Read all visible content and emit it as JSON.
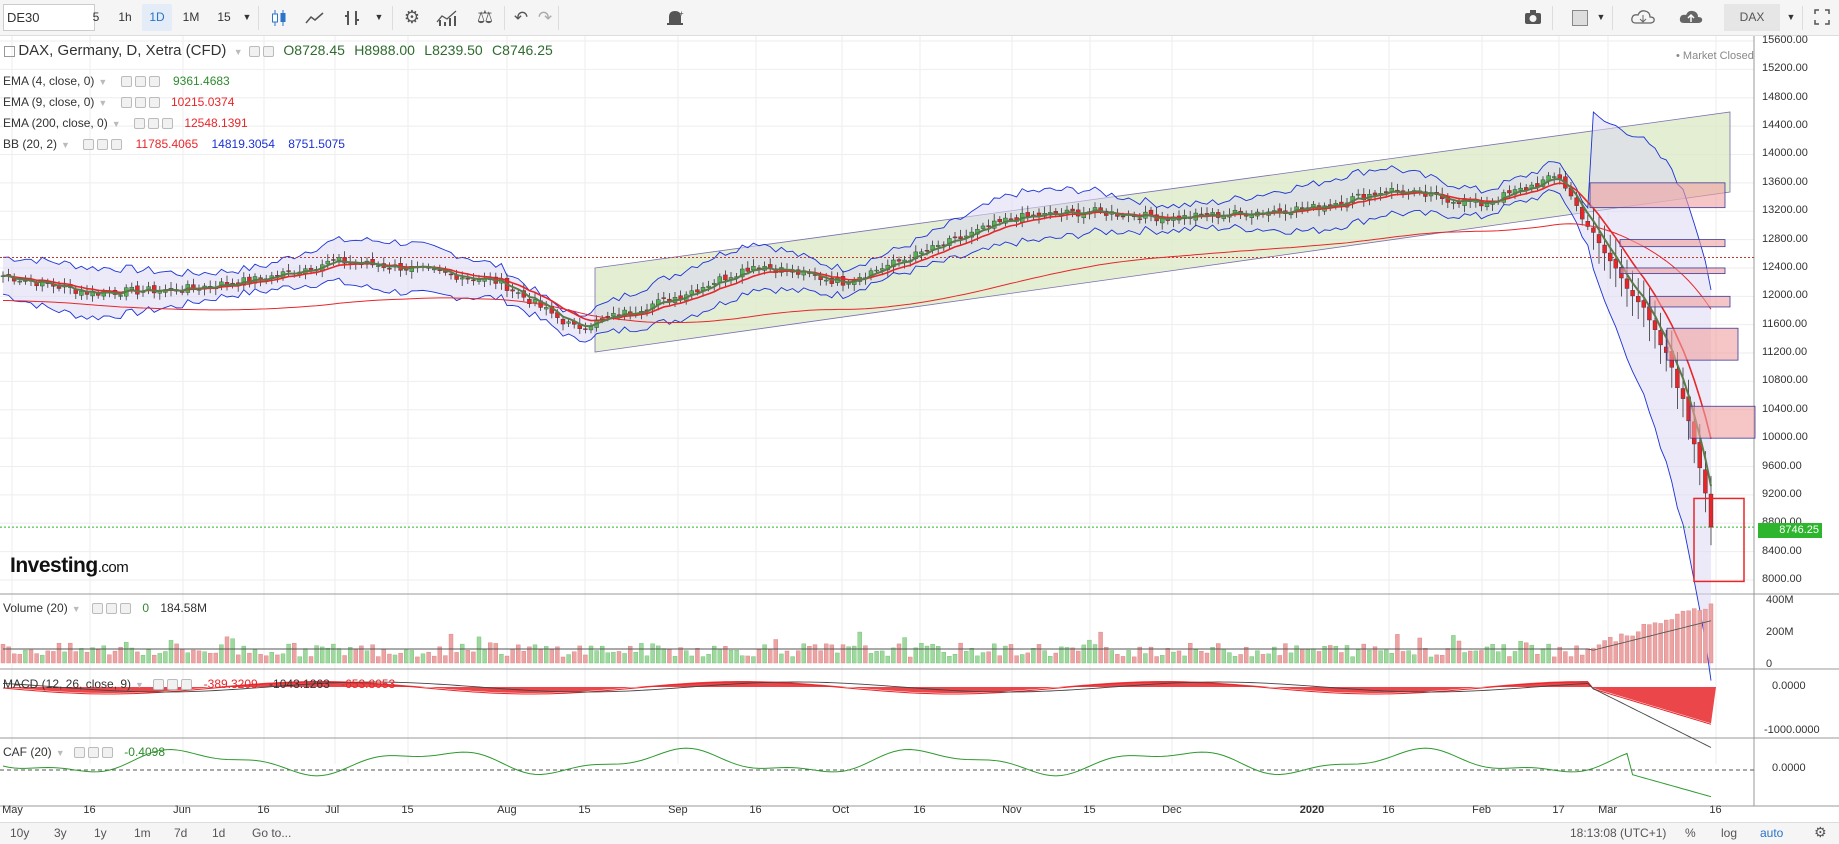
{
  "toolbar": {
    "symbol": "DE30",
    "intervals": [
      "5",
      "1h",
      "1D",
      "1M",
      "15"
    ],
    "active_interval": "1D",
    "right_label": "DAX"
  },
  "legend": {
    "main_title": "DAX, Germany, D, Xetra (CFD)",
    "ohlc": {
      "O": "O8728.45",
      "H": "H8988.00",
      "L": "L8239.50",
      "C": "C8746.25"
    },
    "market_status": "• Market Closed",
    "indicators": [
      {
        "label": "EMA (4, close, 0)",
        "values": [
          "9361.4683"
        ],
        "colors": [
          "#2e8b2e"
        ]
      },
      {
        "label": "EMA (9, close, 0)",
        "values": [
          "10215.0374"
        ],
        "colors": [
          "#e8262a"
        ]
      },
      {
        "label": "EMA (200, close, 0)",
        "values": [
          "12548.1391"
        ],
        "colors": [
          "#e8262a"
        ]
      },
      {
        "label": "BB (20, 2)",
        "values": [
          "11785.4065",
          "14819.3054",
          "8751.5075"
        ],
        "colors": [
          "#e8262a",
          "#1b32d6",
          "#1b32d6"
        ]
      }
    ]
  },
  "price_axis": {
    "ticks": [
      "15600.00",
      "15200.00",
      "14800.00",
      "14400.00",
      "14000.00",
      "13600.00",
      "13200.00",
      "12800.00",
      "12400.00",
      "12000.00",
      "11600.00",
      "11200.00",
      "10800.00",
      "10400.00",
      "10000.00",
      "9600.00",
      "9200.00",
      "8800.00",
      "8400.00",
      "8000.00"
    ],
    "last_price": "8746.25"
  },
  "logo": {
    "brand": "Investing",
    "suffix": ".com"
  },
  "volume": {
    "label": "Volume (20)",
    "value_flag": "0",
    "value": "184.58M",
    "ticks": [
      "400M",
      "200M",
      "0"
    ]
  },
  "macd": {
    "label": "MACD (12, 26, close, 9)",
    "values": [
      "-389.3209",
      "-1043.1263",
      "-653.8053"
    ],
    "ticks": [
      "0.0000",
      "-1000.0000"
    ]
  },
  "caf": {
    "label": "CAF (20)",
    "value": "-0.4098",
    "ticks": [
      "0.0000"
    ]
  },
  "time_axis": [
    "May",
    "16",
    "Jun",
    "16",
    "Jul",
    "15",
    "Aug",
    "15",
    "Sep",
    "16",
    "Oct",
    "16",
    "Nov",
    "15",
    "Dec",
    "2020",
    "16",
    "Feb",
    "17",
    "Mar",
    "16"
  ],
  "bottom_bar": {
    "ranges": [
      "10y",
      "3y",
      "1y",
      "1m",
      "7d",
      "1d"
    ],
    "goto": "Go to...",
    "clock": "18:13:08 (UTC+1)",
    "percent": "%",
    "log": "log",
    "auto": "auto"
  },
  "colors": {
    "up": "#53b253",
    "down": "#e8262a",
    "bb": "#1b32d6",
    "channel": "#d9e8c4",
    "accent": "#2a74c9"
  },
  "chart_data": {
    "type": "candlestick",
    "title": "DAX, Germany, D, Xetra (CFD)",
    "ylim": [
      7900,
      15650
    ],
    "last_close": 8746.25,
    "approx_close_path": [
      [
        "May",
        12300
      ],
      [
        "mid-May",
        12050
      ],
      [
        "Jun",
        12100
      ],
      [
        "mid-Jun",
        12250
      ],
      [
        "Jul",
        12500
      ],
      [
        "mid-Jul",
        12400
      ],
      [
        "Aug",
        12200
      ],
      [
        "mid-Aug",
        11550
      ],
      [
        "Sep",
        12000
      ],
      [
        "mid-Sep",
        12450
      ],
      [
        "Oct",
        12200
      ],
      [
        "mid-Oct",
        12600
      ],
      [
        "Nov",
        13100
      ],
      [
        "mid-Nov",
        13200
      ],
      [
        "Dec",
        13100
      ],
      [
        "2020",
        13250
      ],
      [
        "mid-Jan",
        13500
      ],
      [
        "Feb",
        13400
      ],
      [
        "mid-Feb",
        13700
      ],
      [
        "late-Feb",
        12500
      ],
      [
        "Mar",
        11500
      ],
      [
        "mid-Mar",
        9200
      ],
      [
        "Mar 16",
        8746.25
      ]
    ]
  }
}
